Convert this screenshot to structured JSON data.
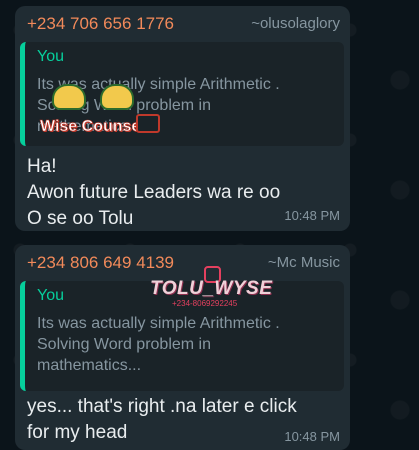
{
  "messages": [
    {
      "sender_phone": "+234 706 656 1776",
      "sender_alias": "~olusolaglory",
      "quote": {
        "author": "You",
        "text": "Its was actually simple Arithmetic .\nSolving Word problem in\nmathematics..."
      },
      "text": "Ha!\nAwon future Leaders wa re oo\nO se oo Tolu",
      "time": "10:48 PM"
    },
    {
      "sender_phone": "+234 806 649 4139",
      "sender_alias": "~Mc Music",
      "quote": {
        "author": "You",
        "text": "Its was actually simple Arithmetic .\nSolving Word problem in\nmathematics..."
      },
      "text": "yes... that's right .na later e click\nfor my head",
      "time": "10:48 PM"
    }
  ],
  "watermarks": {
    "wise_counsel": "Wise Counsel",
    "tolu_wyse": "TOLU_WYSE",
    "tolu_phone": "+234-8069292245"
  },
  "colors": {
    "background": "#0b141a",
    "bubble": "#202c33",
    "sender_name": "#f28a5a",
    "quote_bar": "#06cf9c",
    "text": "#e9edef",
    "meta": "#8696a0"
  }
}
